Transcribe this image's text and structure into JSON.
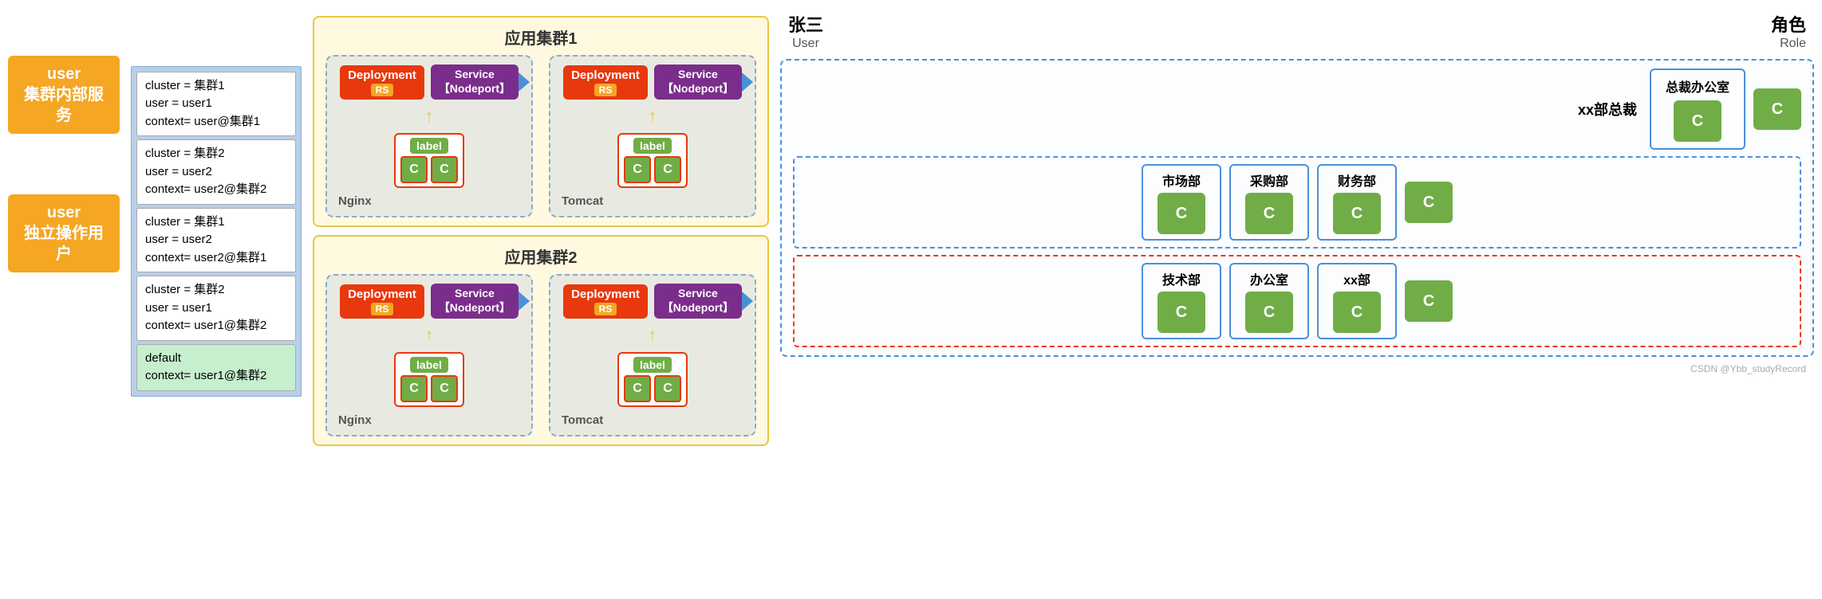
{
  "left": {
    "label1_line1": "user",
    "label1_line2": "集群内部服务",
    "label2_line1": "user",
    "label2_line2": "独立操作用户"
  },
  "config": {
    "items": [
      {
        "lines": [
          "cluster = 集群1",
          "user = user1",
          "context= user@集群1"
        ],
        "type": "normal"
      },
      {
        "lines": [
          "cluster = 集群2",
          "user = user2",
          "context= user2@集群2"
        ],
        "type": "normal"
      },
      {
        "lines": [
          "cluster = 集群1",
          "user = user2",
          "context= user2@集群1"
        ],
        "type": "normal"
      },
      {
        "lines": [
          "cluster = 集群2",
          "user = user1",
          "context= user1@集群2"
        ],
        "type": "normal"
      },
      {
        "lines": [
          "default",
          "context= user1@集群2"
        ],
        "type": "green"
      }
    ]
  },
  "cluster1": {
    "title": "应用集群1",
    "groups": [
      {
        "label": "Nginx",
        "deployment": "Deployment",
        "rs": "RS",
        "service_line1": "Service",
        "service_line2": "【Nodeport】",
        "pod_label": "label",
        "pods": [
          "C",
          "C"
        ]
      },
      {
        "label": "Tomcat",
        "deployment": "Deployment",
        "rs": "RS",
        "service_line1": "Service",
        "service_line2": "【Nodeport】",
        "pod_label": "label",
        "pods": [
          "C",
          "C"
        ]
      }
    ]
  },
  "cluster2": {
    "title": "应用集群2",
    "groups": [
      {
        "label": "Nginx",
        "deployment": "Deployment",
        "rs": "RS",
        "service_line1": "Service",
        "service_line2": "【Nodeport】",
        "pod_label": "label",
        "pods": [
          "C",
          "C"
        ]
      },
      {
        "label": "Tomcat",
        "deployment": "Deployment",
        "rs": "RS",
        "service_line1": "Service",
        "service_line2": "【Nodeport】",
        "pod_label": "label",
        "pods": [
          "C",
          "C"
        ]
      }
    ]
  },
  "right": {
    "user_name": "张三",
    "user_sub": "User",
    "role_title": "角色",
    "role_sub": "Role",
    "org_title": "xx部总裁",
    "dept1_title": "总裁办公室",
    "dept1_c": "C",
    "dept2_title": "市场部",
    "dept2_c": "C",
    "dept3_title": "采购部",
    "dept3_c": "C",
    "dept4_title": "财务部",
    "dept4_c": "C",
    "dept5_title": "技术部",
    "dept5_c": "C",
    "dept6_title": "办公室",
    "dept6_c": "C",
    "dept7_title": "xx部",
    "dept7_c": "C",
    "role_c1": "C",
    "role_c2": "C",
    "watermark": "CSDN @Ybb_studyRecord"
  }
}
